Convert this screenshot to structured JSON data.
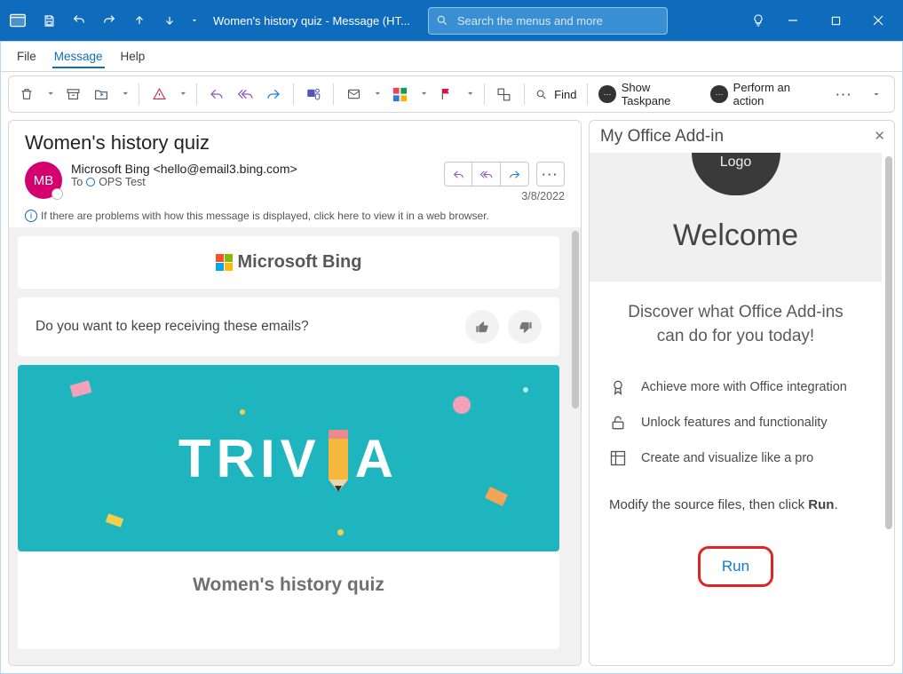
{
  "titlebar": {
    "title": "Women's history quiz  -  Message (HT...",
    "search_placeholder": "Search the menus and more"
  },
  "tabs": {
    "file": "File",
    "message": "Message",
    "help": "Help"
  },
  "ribbon": {
    "find": "Find",
    "show_taskpane": "Show Taskpane",
    "perform_action": "Perform an action"
  },
  "message": {
    "subject": "Women's history quiz",
    "avatar_initials": "MB",
    "from": "Microsoft Bing <hello@email3.bing.com>",
    "to_label": "To",
    "to_value": "OPS Test",
    "date": "3/8/2022",
    "info_banner": "If there are problems with how this message is displayed, click here to view it in a web browser."
  },
  "body": {
    "bing_logo_text": "Microsoft Bing",
    "feedback_question": "Do you want to keep receiving these emails?",
    "trivia_word_a": "TRIV",
    "trivia_word_b": "A",
    "quiz_title": "Women's history quiz"
  },
  "addin": {
    "header": "My Office Add-in",
    "logo_text": "Logo",
    "welcome": "Welcome",
    "tagline_a": "Discover what Office Add-ins",
    "tagline_b": "can do for you today!",
    "feat1": "Achieve more with Office integration",
    "feat2": "Unlock features and functionality",
    "feat3": "Create and visualize like a pro",
    "modify_a": "Modify the source files, then click ",
    "modify_b": "Run",
    "modify_c": ".",
    "run_label": "Run"
  }
}
